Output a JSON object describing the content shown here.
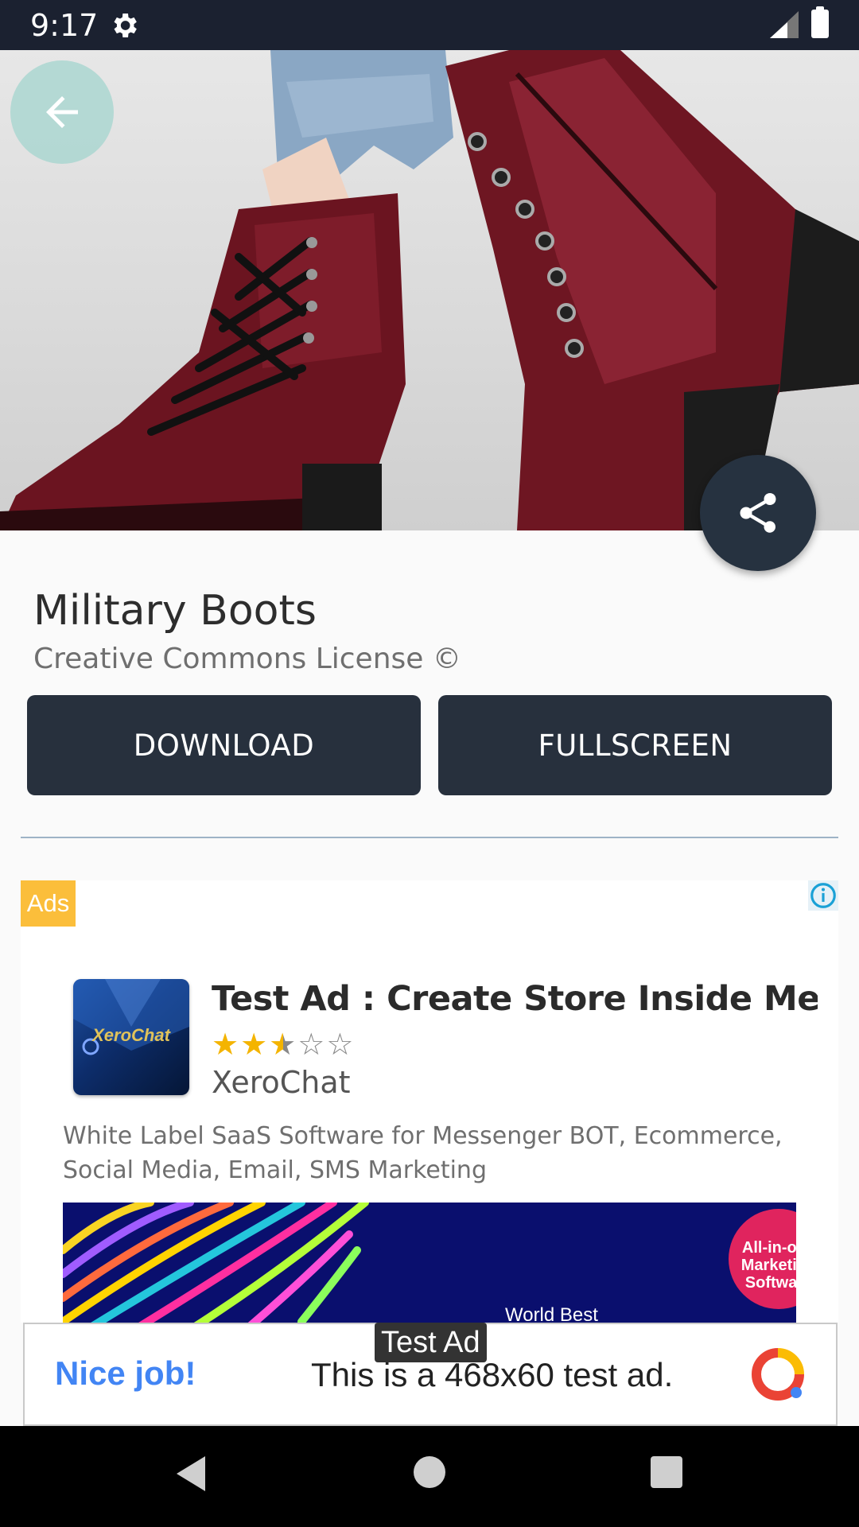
{
  "status_bar": {
    "time": "9:17",
    "icons": [
      "gear-icon",
      "signal-icon",
      "battery-icon"
    ]
  },
  "hero": {
    "image": "burgundy-leather-lace-up-ankle-boots",
    "back_icon": "arrow-left-icon",
    "share_icon": "share-icon"
  },
  "detail": {
    "title": "Military Boots",
    "license": "Creative Commons License ©",
    "download_label": "DOWNLOAD",
    "fullscreen_label": "FULLSCREEN"
  },
  "ad": {
    "badge": "Ads",
    "info_icon": "info-icon",
    "logo_text": "XeroChat",
    "headline": "Test Ad : Create Store Inside Messe",
    "rating": 2.5,
    "advertiser": "XeroChat",
    "body": "White Label SaaS Software for Messenger BOT, Ecommerce, Social Media, Email, SMS Marketing",
    "image_badge": "All-in-one Marketing Software",
    "image_caption": "World Best"
  },
  "banner": {
    "label": "Test Ad",
    "nice": "Nice job!",
    "text": "This is a 468x60 test ad."
  },
  "navbar": {
    "icons": [
      "back-triangle-icon",
      "home-circle-icon",
      "recents-square-icon"
    ]
  },
  "colors": {
    "status_bar": "#1b2130",
    "button_bg": "#27303d",
    "ads_badge": "#fbbe3b",
    "star": "#f4b400",
    "nice_blue": "#4285f4"
  }
}
